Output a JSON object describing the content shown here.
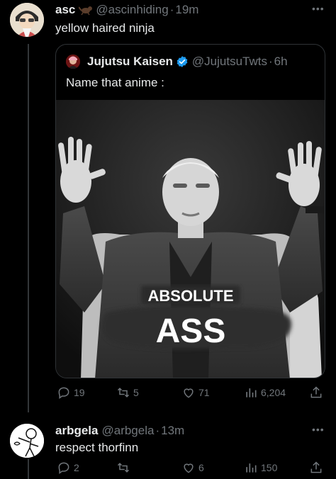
{
  "posts": [
    {
      "author": "asc",
      "handle": "@ascinhiding",
      "time": "19m",
      "text": "yellow haired ninja",
      "quote": {
        "author": "Jujutsu Kaisen",
        "handle": "@JujutsuTwts",
        "time": "6h",
        "text": "Name that anime :",
        "meme_top": "ABSOLUTE",
        "meme_bottom": "ASS"
      },
      "stats": {
        "replies": "19",
        "reposts": "5",
        "likes": "71",
        "views": "6,204"
      }
    },
    {
      "author": "arbgela",
      "handle": "@arbgela",
      "time": "13m",
      "text": "respect thorfinn",
      "stats": {
        "replies": "2",
        "reposts": "",
        "likes": "6",
        "views": "150"
      }
    }
  ],
  "icons": {
    "more": "more-horizontal-icon",
    "reply": "reply-icon",
    "repost": "repost-icon",
    "like": "heart-icon",
    "views": "views-icon",
    "share": "share-icon",
    "verified": "verified-badge-icon",
    "emoji": "lizard-emoji-icon"
  },
  "colors": {
    "background": "#000000",
    "text": "#e7e9ea",
    "muted": "#71767b",
    "verified": "#1d9bf0",
    "border": "#2f3336"
  }
}
